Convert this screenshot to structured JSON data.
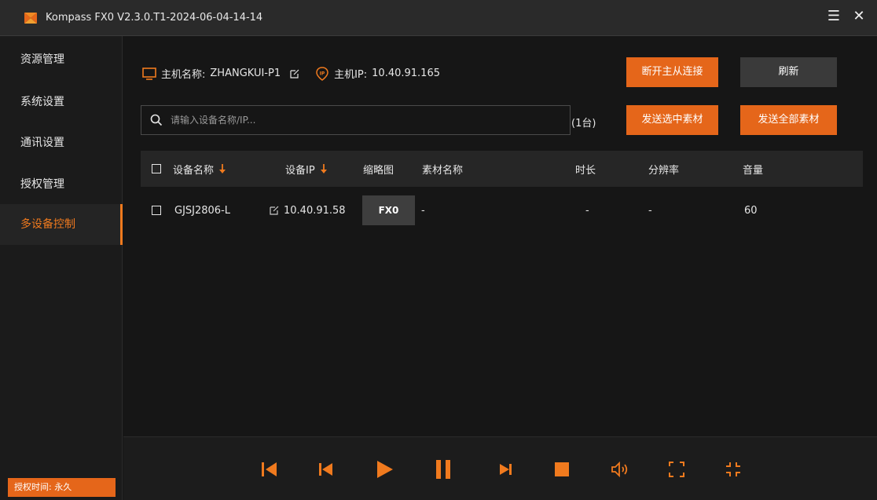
{
  "app": {
    "title": "Kompass FX0 V2.3.0.T1-2024-06-04-14-14",
    "brand_color": "#e5661a"
  },
  "titlebar": {
    "menu_icon": "hamburger-menu-icon",
    "menu_glyph": "☰",
    "close_icon": "close-icon",
    "close_glyph": "✕"
  },
  "sidebar": {
    "items": [
      {
        "label": "资源管理"
      },
      {
        "label": "系统设置"
      },
      {
        "label": "通讯设置"
      },
      {
        "label": "授权管理"
      },
      {
        "label": "多设备控制",
        "active": true
      }
    ],
    "license": "授权时间: 永久"
  },
  "host": {
    "name_label": "主机名称:",
    "name_value": "ZHANGKUI-P1",
    "ip_label": "主机IP:",
    "ip_value": "10.40.91.165"
  },
  "buttons": {
    "disconnect": "断开主从连接",
    "refresh": "刷新",
    "send_selected": "发送选中素材",
    "send_all": "发送全部素材"
  },
  "search": {
    "placeholder": "请输入设备名称/IP...",
    "count": "(1台)"
  },
  "table": {
    "headers": {
      "device_name": "设备名称",
      "device_ip": "设备IP",
      "thumbnail": "缩略图",
      "material_name": "素材名称",
      "duration": "时长",
      "resolution": "分辨率",
      "volume": "音量"
    },
    "rows": [
      {
        "device_name": "GJSJ2806-L",
        "device_ip": "10.40.91.58",
        "thumbnail": "FX0",
        "material_name": "-",
        "duration": "-",
        "resolution": "-",
        "volume": "60"
      }
    ]
  },
  "controls": [
    "skip-to-start-icon",
    "previous-icon",
    "play-icon",
    "pause-icon",
    "next-icon",
    "stop-icon",
    "volume-icon",
    "fullscreen-icon",
    "exit-fullscreen-icon"
  ]
}
